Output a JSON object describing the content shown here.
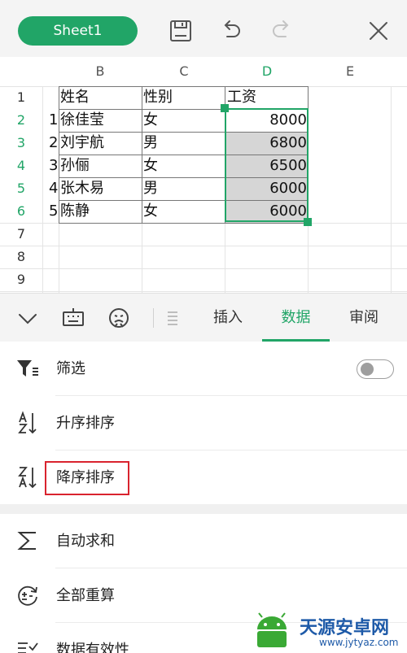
{
  "toolbar": {
    "sheet_name": "Sheet1",
    "icons": [
      "save-icon",
      "undo-icon",
      "redo-icon",
      "close-icon"
    ]
  },
  "grid": {
    "columns": [
      "B",
      "C",
      "D",
      "E"
    ],
    "active_column": "D",
    "rows": [
      "1",
      "2",
      "3",
      "4",
      "5",
      "6",
      "7",
      "8",
      "9"
    ],
    "header_row": [
      "姓名",
      "性别",
      "工资"
    ],
    "data_rows": [
      {
        "index": "1",
        "name": "徐佳莹",
        "gender": "女",
        "salary": "8000"
      },
      {
        "index": "2",
        "name": "刘宇航",
        "gender": "男",
        "salary": "6800"
      },
      {
        "index": "3",
        "name": "孙俪",
        "gender": "女",
        "salary": "6500"
      },
      {
        "index": "4",
        "name": "张木易",
        "gender": "男",
        "salary": "6000"
      },
      {
        "index": "5",
        "name": "陈静",
        "gender": "女",
        "salary": "6000"
      }
    ]
  },
  "panel": {
    "icons": [
      "collapse-chevron-icon",
      "keyboard-icon",
      "emoji-icon",
      "format-icon"
    ],
    "tabs": [
      "插入",
      "数据",
      "审阅"
    ],
    "active_tab": "数据",
    "items": [
      {
        "label": "筛选",
        "icon": "filter-icon",
        "has_toggle": true,
        "toggle_on": false
      },
      {
        "label": "升序排序",
        "icon": "sort-ascending-icon"
      },
      {
        "label": "降序排序",
        "icon": "sort-descending-icon",
        "highlighted": true
      },
      {
        "label": "自动求和",
        "icon": "sum-icon"
      },
      {
        "label": "全部重算",
        "icon": "recalculate-icon"
      },
      {
        "label": "数据有效性",
        "icon": "data-validation-icon"
      }
    ]
  },
  "colors": {
    "accent": "#21a567",
    "highlight": "#d9232e",
    "selection_fill": "#d6d6d6"
  },
  "watermark": {
    "text": "天源安卓网",
    "url": "www.jytyaz.com"
  }
}
